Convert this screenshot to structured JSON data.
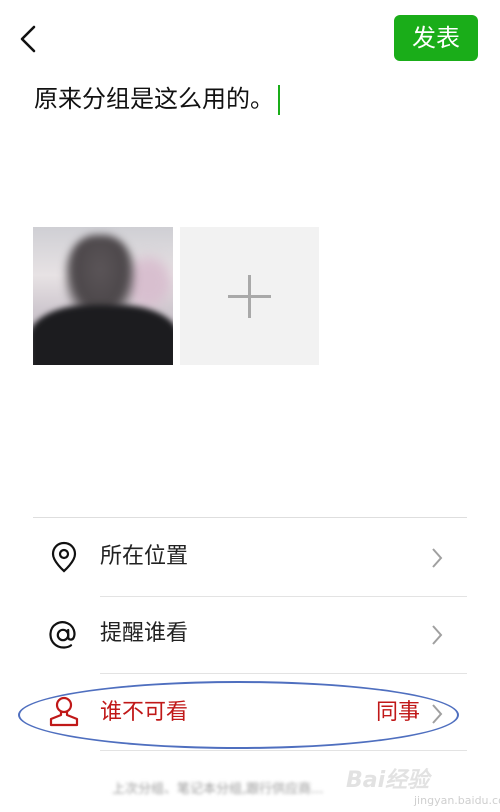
{
  "header": {
    "publish_label": "发表"
  },
  "post": {
    "text": "原来分组是这么用的。"
  },
  "options": [
    {
      "label": "所在位置",
      "value": ""
    },
    {
      "label": "提醒谁看",
      "value": ""
    },
    {
      "label": "谁不可看",
      "value": "同事"
    }
  ],
  "footer": {
    "hint": "上次分组、笔记本分组,跟行供应商..."
  },
  "watermark": {
    "text": "Bai经验",
    "sub": "jingyan.baidu.com"
  },
  "colors": {
    "accent": "#1aad19",
    "alert_text": "#c01818",
    "annotation": "#4f6fbf"
  }
}
